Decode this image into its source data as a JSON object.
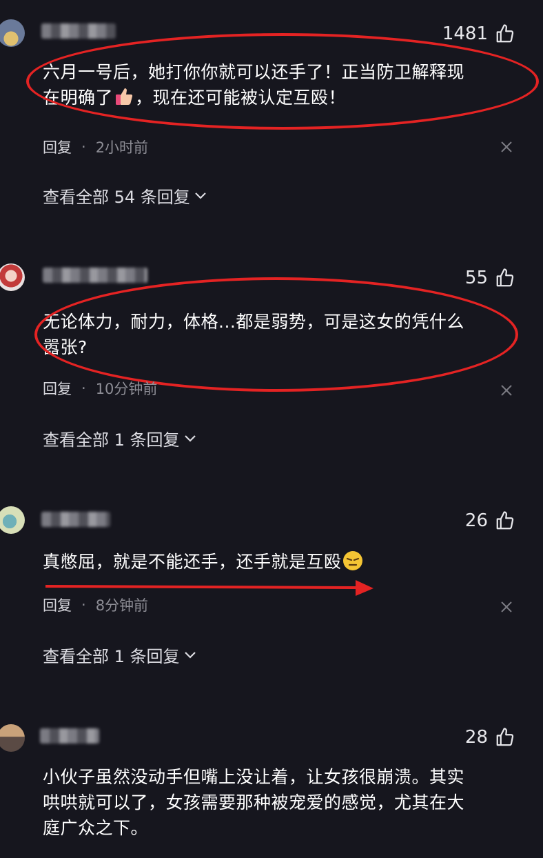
{
  "comments": [
    {
      "likes": "1481",
      "text_line1": "六月一号后，她打你你就可以还手了！正当防卫解释现",
      "text_line2_a": "在明确了",
      "text_line2_b": "，现在还可能被认定互殴！",
      "reply_label": "回复",
      "dot": "·",
      "time": "2小时前",
      "view_replies": "查看全部 54 条回复"
    },
    {
      "likes": "55",
      "text_line1": "无论体力，耐力，体格...都是弱势，可是这女的凭什么",
      "text_line2": "嚣张?",
      "reply_label": "回复",
      "dot": "·",
      "time": "10分钟前",
      "view_replies": "查看全部 1 条回复"
    },
    {
      "likes": "26",
      "text_line1": "真憋屈，就是不能还手，还手就是互殴",
      "reply_label": "回复",
      "dot": "·",
      "time": "8分钟前",
      "view_replies": "查看全部 1 条回复"
    },
    {
      "likes": "28",
      "text_line1": "小伙子虽然没动手但嘴上没让着，让女孩很崩溃。其实",
      "text_line2": "哄哄就可以了，女孩需要那种被宠爱的感觉，尤其在大",
      "text_line3": "庭广众之下。"
    }
  ],
  "colors": {
    "background": "#16161e",
    "annotation_red": "#e42323"
  }
}
